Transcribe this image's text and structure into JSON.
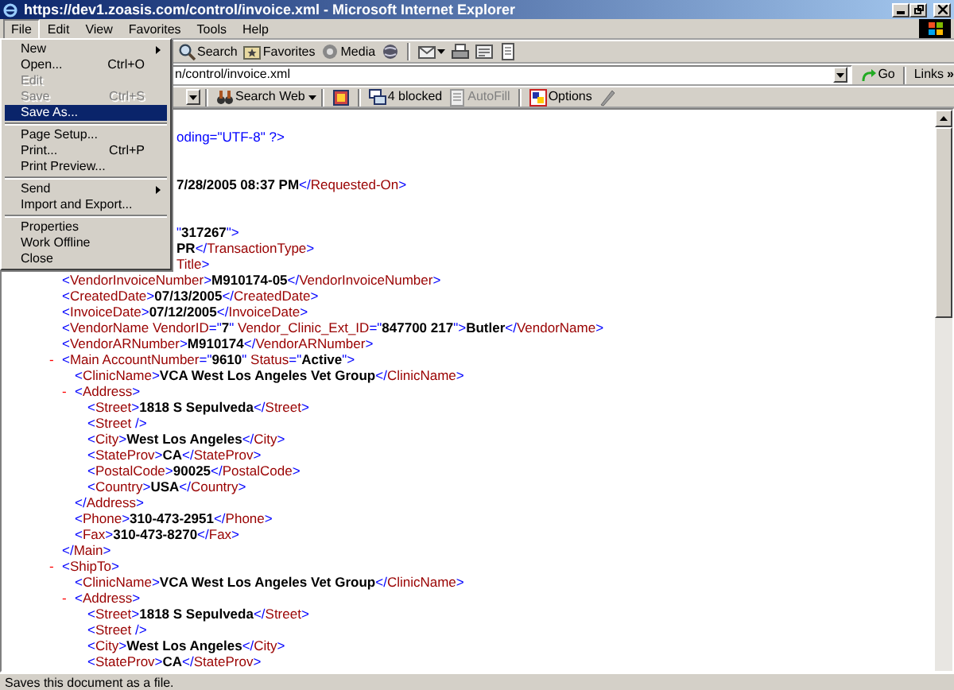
{
  "window": {
    "title": "https://dev1.zoasis.com/control/invoice.xml - Microsoft Internet Explorer"
  },
  "menu_bar": [
    {
      "label": "File",
      "selected": true
    },
    {
      "label": "Edit",
      "selected": false
    },
    {
      "label": "View",
      "selected": false
    },
    {
      "label": "Favorites",
      "selected": false
    },
    {
      "label": "Tools",
      "selected": false
    },
    {
      "label": "Help",
      "selected": false
    }
  ],
  "file_menu": [
    {
      "kind": "item",
      "label": "New",
      "submenu": true,
      "disabled": false,
      "selected": false
    },
    {
      "kind": "item",
      "label": "Open...",
      "shortcut": "Ctrl+O",
      "submenu": false,
      "disabled": false,
      "selected": false
    },
    {
      "kind": "item",
      "label": "Edit",
      "submenu": false,
      "disabled": true,
      "selected": false
    },
    {
      "kind": "item",
      "label": "Save",
      "shortcut": "Ctrl+S",
      "submenu": false,
      "disabled": true,
      "selected": false
    },
    {
      "kind": "item",
      "label": "Save As...",
      "submenu": false,
      "disabled": false,
      "selected": true
    },
    {
      "kind": "separator"
    },
    {
      "kind": "item",
      "label": "Page Setup...",
      "submenu": false,
      "disabled": false,
      "selected": false
    },
    {
      "kind": "item",
      "label": "Print...",
      "shortcut": "Ctrl+P",
      "submenu": false,
      "disabled": false,
      "selected": false
    },
    {
      "kind": "item",
      "label": "Print Preview...",
      "submenu": false,
      "disabled": false,
      "selected": false
    },
    {
      "kind": "separator"
    },
    {
      "kind": "item",
      "label": "Send",
      "submenu": true,
      "disabled": false,
      "selected": false
    },
    {
      "kind": "item",
      "label": "Import and Export...",
      "submenu": false,
      "disabled": false,
      "selected": false
    },
    {
      "kind": "separator"
    },
    {
      "kind": "item",
      "label": "Properties",
      "submenu": false,
      "disabled": false,
      "selected": false
    },
    {
      "kind": "item",
      "label": "Work Offline",
      "submenu": false,
      "disabled": false,
      "selected": false
    },
    {
      "kind": "item",
      "label": "Close",
      "submenu": false,
      "disabled": false,
      "selected": false
    }
  ],
  "toolbar": {
    "search": "Search",
    "favorites": "Favorites",
    "media": "Media"
  },
  "address_bar": {
    "value": "n/control/invoice.xml",
    "go": "Go",
    "links": "Links",
    "links_more": "»"
  },
  "search_toolbar": {
    "search_web": "Search Web",
    "blocked": "4 blocked",
    "autofill": {
      "label": "AutoFill",
      "disabled": true
    },
    "options": "Options"
  },
  "xml_lines": [
    {
      "kind": "cut",
      "parts": [
        {
          "kind": "markup",
          "text": "oding=\"UTF-8\" ?>"
        }
      ]
    },
    {
      "kind": "blank"
    },
    {
      "kind": "blank"
    },
    {
      "kind": "cut",
      "parts": [
        {
          "kind": "value",
          "text": "7/28/2005 08:37 PM"
        },
        {
          "kind": "markup",
          "text": "</"
        },
        {
          "kind": "name",
          "text": "Requested-On"
        },
        {
          "kind": "markup",
          "text": ">"
        }
      ]
    },
    {
      "kind": "blank"
    },
    {
      "kind": "blank"
    },
    {
      "kind": "cut",
      "parts": [
        {
          "kind": "markup",
          "text": "\""
        },
        {
          "kind": "value",
          "text": "317267"
        },
        {
          "kind": "markup",
          "text": "\">"
        }
      ]
    },
    {
      "kind": "cut",
      "parts": [
        {
          "kind": "value",
          "text": "PR"
        },
        {
          "kind": "markup",
          "text": "</"
        },
        {
          "kind": "name",
          "text": "TransactionType"
        },
        {
          "kind": "markup",
          "text": ">"
        }
      ]
    },
    {
      "kind": "cut",
      "parts": [
        {
          "kind": "name",
          "text": "Title"
        },
        {
          "kind": "markup",
          "text": ">"
        }
      ]
    },
    {
      "kind": "node",
      "parts": [
        {
          "kind": "markup",
          "text": "<"
        },
        {
          "kind": "name",
          "text": "VendorInvoiceNumber"
        },
        {
          "kind": "markup",
          "text": ">"
        },
        {
          "kind": "value",
          "text": "M910174-05"
        },
        {
          "kind": "markup",
          "text": "</"
        },
        {
          "kind": "name",
          "text": "VendorInvoiceNumber"
        },
        {
          "kind": "markup",
          "text": ">"
        }
      ]
    },
    {
      "kind": "node",
      "parts": [
        {
          "kind": "markup",
          "text": "<"
        },
        {
          "kind": "name",
          "text": "CreatedDate"
        },
        {
          "kind": "markup",
          "text": ">"
        },
        {
          "kind": "value",
          "text": "07/13/2005"
        },
        {
          "kind": "markup",
          "text": "</"
        },
        {
          "kind": "name",
          "text": "CreatedDate"
        },
        {
          "kind": "markup",
          "text": ">"
        }
      ]
    },
    {
      "kind": "node",
      "parts": [
        {
          "kind": "markup",
          "text": "<"
        },
        {
          "kind": "name",
          "text": "InvoiceDate"
        },
        {
          "kind": "markup",
          "text": ">"
        },
        {
          "kind": "value",
          "text": "07/12/2005"
        },
        {
          "kind": "markup",
          "text": "</"
        },
        {
          "kind": "name",
          "text": "InvoiceDate"
        },
        {
          "kind": "markup",
          "text": ">"
        }
      ]
    },
    {
      "kind": "node",
      "parts": [
        {
          "kind": "markup",
          "text": "<"
        },
        {
          "kind": "name",
          "text": "VendorName VendorID"
        },
        {
          "kind": "markup",
          "text": "=\""
        },
        {
          "kind": "value",
          "text": "7"
        },
        {
          "kind": "markup",
          "text": "\" "
        },
        {
          "kind": "name",
          "text": "Vendor_Clinic_Ext_ID"
        },
        {
          "kind": "markup",
          "text": "=\""
        },
        {
          "kind": "value",
          "text": "847700 217"
        },
        {
          "kind": "markup",
          "text": "\">"
        },
        {
          "kind": "value",
          "text": "Butler"
        },
        {
          "kind": "markup",
          "text": "</"
        },
        {
          "kind": "name",
          "text": "VendorName"
        },
        {
          "kind": "markup",
          "text": ">"
        }
      ]
    },
    {
      "kind": "node",
      "parts": [
        {
          "kind": "markup",
          "text": "<"
        },
        {
          "kind": "name",
          "text": "VendorARNumber"
        },
        {
          "kind": "markup",
          "text": ">"
        },
        {
          "kind": "value",
          "text": "M910174"
        },
        {
          "kind": "markup",
          "text": "</"
        },
        {
          "kind": "name",
          "text": "VendorARNumber"
        },
        {
          "kind": "markup",
          "text": ">"
        }
      ]
    },
    {
      "kind": "node",
      "toggle": "-",
      "parts": [
        {
          "kind": "markup",
          "text": "<"
        },
        {
          "kind": "name",
          "text": "Main AccountNumber"
        },
        {
          "kind": "markup",
          "text": "=\""
        },
        {
          "kind": "value",
          "text": "9610"
        },
        {
          "kind": "markup",
          "text": "\" "
        },
        {
          "kind": "name",
          "text": "Status"
        },
        {
          "kind": "markup",
          "text": "=\""
        },
        {
          "kind": "value",
          "text": "Active"
        },
        {
          "kind": "markup",
          "text": "\">"
        }
      ],
      "children": [
        {
          "kind": "node",
          "parts": [
            {
              "kind": "markup",
              "text": "<"
            },
            {
              "kind": "name",
              "text": "ClinicName"
            },
            {
              "kind": "markup",
              "text": ">"
            },
            {
              "kind": "value",
              "text": "VCA West Los Angeles Vet Group"
            },
            {
              "kind": "markup",
              "text": "</"
            },
            {
              "kind": "name",
              "text": "ClinicName"
            },
            {
              "kind": "markup",
              "text": ">"
            }
          ]
        },
        {
          "kind": "node",
          "toggle": "-",
          "parts": [
            {
              "kind": "markup",
              "text": "<"
            },
            {
              "kind": "name",
              "text": "Address"
            },
            {
              "kind": "markup",
              "text": ">"
            }
          ],
          "children": [
            {
              "kind": "node",
              "parts": [
                {
                  "kind": "markup",
                  "text": "<"
                },
                {
                  "kind": "name",
                  "text": "Street"
                },
                {
                  "kind": "markup",
                  "text": ">"
                },
                {
                  "kind": "value",
                  "text": "1818 S Sepulveda"
                },
                {
                  "kind": "markup",
                  "text": "</"
                },
                {
                  "kind": "name",
                  "text": "Street"
                },
                {
                  "kind": "markup",
                  "text": ">"
                }
              ]
            },
            {
              "kind": "node",
              "parts": [
                {
                  "kind": "markup",
                  "text": "<"
                },
                {
                  "kind": "name",
                  "text": "Street"
                },
                {
                  "kind": "markup",
                  "text": " />"
                }
              ]
            },
            {
              "kind": "node",
              "parts": [
                {
                  "kind": "markup",
                  "text": "<"
                },
                {
                  "kind": "name",
                  "text": "City"
                },
                {
                  "kind": "markup",
                  "text": ">"
                },
                {
                  "kind": "value",
                  "text": "West Los Angeles"
                },
                {
                  "kind": "markup",
                  "text": "</"
                },
                {
                  "kind": "name",
                  "text": "City"
                },
                {
                  "kind": "markup",
                  "text": ">"
                }
              ]
            },
            {
              "kind": "node",
              "parts": [
                {
                  "kind": "markup",
                  "text": "<"
                },
                {
                  "kind": "name",
                  "text": "StateProv"
                },
                {
                  "kind": "markup",
                  "text": ">"
                },
                {
                  "kind": "value",
                  "text": "CA"
                },
                {
                  "kind": "markup",
                  "text": "</"
                },
                {
                  "kind": "name",
                  "text": "StateProv"
                },
                {
                  "kind": "markup",
                  "text": ">"
                }
              ]
            },
            {
              "kind": "node",
              "parts": [
                {
                  "kind": "markup",
                  "text": "<"
                },
                {
                  "kind": "name",
                  "text": "PostalCode"
                },
                {
                  "kind": "markup",
                  "text": ">"
                },
                {
                  "kind": "value",
                  "text": "90025"
                },
                {
                  "kind": "markup",
                  "text": "</"
                },
                {
                  "kind": "name",
                  "text": "PostalCode"
                },
                {
                  "kind": "markup",
                  "text": ">"
                }
              ]
            },
            {
              "kind": "node",
              "parts": [
                {
                  "kind": "markup",
                  "text": "<"
                },
                {
                  "kind": "name",
                  "text": "Country"
                },
                {
                  "kind": "markup",
                  "text": ">"
                },
                {
                  "kind": "value",
                  "text": "USA"
                },
                {
                  "kind": "markup",
                  "text": "</"
                },
                {
                  "kind": "name",
                  "text": "Country"
                },
                {
                  "kind": "markup",
                  "text": ">"
                }
              ]
            }
          ],
          "close": [
            {
              "kind": "markup",
              "text": "</"
            },
            {
              "kind": "name",
              "text": "Address"
            },
            {
              "kind": "markup",
              "text": ">"
            }
          ]
        },
        {
          "kind": "node",
          "parts": [
            {
              "kind": "markup",
              "text": "<"
            },
            {
              "kind": "name",
              "text": "Phone"
            },
            {
              "kind": "markup",
              "text": ">"
            },
            {
              "kind": "value",
              "text": "310-473-2951"
            },
            {
              "kind": "markup",
              "text": "</"
            },
            {
              "kind": "name",
              "text": "Phone"
            },
            {
              "kind": "markup",
              "text": ">"
            }
          ]
        },
        {
          "kind": "node",
          "parts": [
            {
              "kind": "markup",
              "text": "<"
            },
            {
              "kind": "name",
              "text": "Fax"
            },
            {
              "kind": "markup",
              "text": ">"
            },
            {
              "kind": "value",
              "text": "310-473-8270"
            },
            {
              "kind": "markup",
              "text": "</"
            },
            {
              "kind": "name",
              "text": "Fax"
            },
            {
              "kind": "markup",
              "text": ">"
            }
          ]
        }
      ],
      "close": [
        {
          "kind": "markup",
          "text": "</"
        },
        {
          "kind": "name",
          "text": "Main"
        },
        {
          "kind": "markup",
          "text": ">"
        }
      ]
    },
    {
      "kind": "node",
      "toggle": "-",
      "parts": [
        {
          "kind": "markup",
          "text": "<"
        },
        {
          "kind": "name",
          "text": "ShipTo"
        },
        {
          "kind": "markup",
          "text": ">"
        }
      ],
      "children": [
        {
          "kind": "node",
          "parts": [
            {
              "kind": "markup",
              "text": "<"
            },
            {
              "kind": "name",
              "text": "ClinicName"
            },
            {
              "kind": "markup",
              "text": ">"
            },
            {
              "kind": "value",
              "text": "VCA West Los Angeles Vet Group"
            },
            {
              "kind": "markup",
              "text": "</"
            },
            {
              "kind": "name",
              "text": "ClinicName"
            },
            {
              "kind": "markup",
              "text": ">"
            }
          ]
        },
        {
          "kind": "node",
          "toggle": "-",
          "parts": [
            {
              "kind": "markup",
              "text": "<"
            },
            {
              "kind": "name",
              "text": "Address"
            },
            {
              "kind": "markup",
              "text": ">"
            }
          ],
          "children": [
            {
              "kind": "node",
              "parts": [
                {
                  "kind": "markup",
                  "text": "<"
                },
                {
                  "kind": "name",
                  "text": "Street"
                },
                {
                  "kind": "markup",
                  "text": ">"
                },
                {
                  "kind": "value",
                  "text": "1818 S Sepulveda"
                },
                {
                  "kind": "markup",
                  "text": "</"
                },
                {
                  "kind": "name",
                  "text": "Street"
                },
                {
                  "kind": "markup",
                  "text": ">"
                }
              ]
            },
            {
              "kind": "node",
              "parts": [
                {
                  "kind": "markup",
                  "text": "<"
                },
                {
                  "kind": "name",
                  "text": "Street"
                },
                {
                  "kind": "markup",
                  "text": " />"
                }
              ]
            },
            {
              "kind": "node",
              "parts": [
                {
                  "kind": "markup",
                  "text": "<"
                },
                {
                  "kind": "name",
                  "text": "City"
                },
                {
                  "kind": "markup",
                  "text": ">"
                },
                {
                  "kind": "value",
                  "text": "West Los Angeles"
                },
                {
                  "kind": "markup",
                  "text": "</"
                },
                {
                  "kind": "name",
                  "text": "City"
                },
                {
                  "kind": "markup",
                  "text": ">"
                }
              ]
            },
            {
              "kind": "node",
              "parts": [
                {
                  "kind": "markup",
                  "text": "<"
                },
                {
                  "kind": "name",
                  "text": "StateProv"
                },
                {
                  "kind": "markup",
                  "text": ">"
                },
                {
                  "kind": "value",
                  "text": "CA"
                },
                {
                  "kind": "markup",
                  "text": "</"
                },
                {
                  "kind": "name",
                  "text": "StateProv"
                },
                {
                  "kind": "markup",
                  "text": ">"
                }
              ]
            }
          ]
        }
      ]
    }
  ],
  "status_bar": {
    "text": "Saves this document as a file."
  }
}
